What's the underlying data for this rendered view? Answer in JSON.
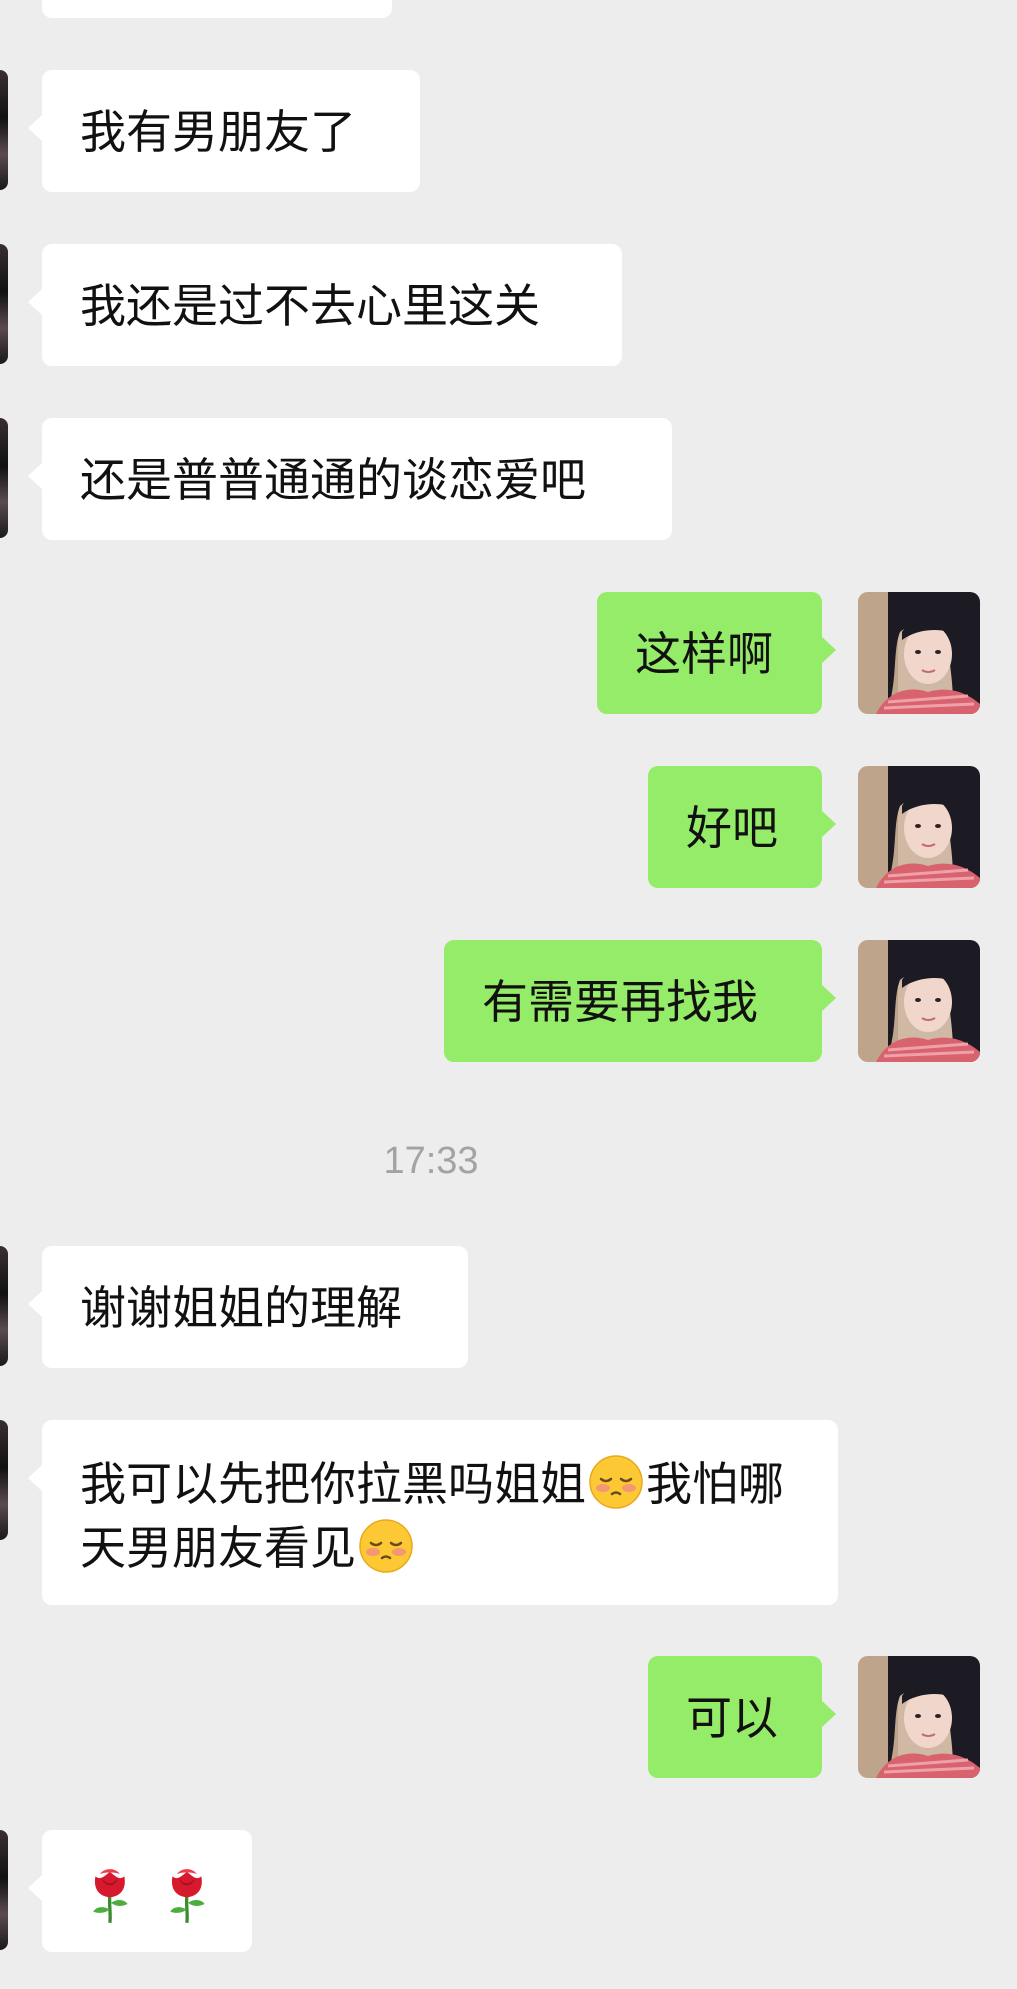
{
  "messages": {
    "m1": "我有男朋友了",
    "m2": "我还是过不去心里这关",
    "m3": "还是普普通通的谈恋爱吧",
    "m4": "这样啊",
    "m5": "好吧",
    "m6": "有需要再找我",
    "m7": "谢谢姐姐的理解",
    "m8a": "我可以先把你拉黑吗姐姐",
    "m8b": "我怕哪天男朋友看见",
    "m9": "可以"
  },
  "timestamp": "17:33",
  "icons": {
    "rose": "rose-emoji",
    "face": "pleading-blush-face-emoji"
  },
  "colors": {
    "background": "#ededed",
    "incoming_bubble": "#ffffff",
    "outgoing_bubble": "#95ec69",
    "timestamp_text": "#a3a3a3"
  }
}
